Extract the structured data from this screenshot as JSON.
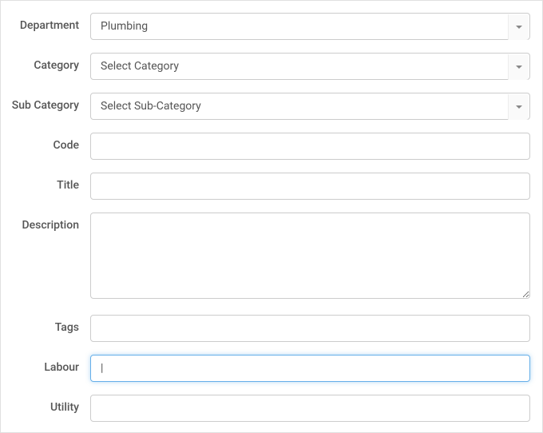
{
  "form": {
    "department": {
      "label": "Department",
      "value": "Plumbing"
    },
    "category": {
      "label": "Category",
      "value": "Select Category"
    },
    "subcategory": {
      "label": "Sub Category",
      "value": "Select Sub-Category"
    },
    "code": {
      "label": "Code",
      "value": ""
    },
    "title": {
      "label": "Title",
      "value": ""
    },
    "description": {
      "label": "Description",
      "value": ""
    },
    "tags": {
      "label": "Tags",
      "value": ""
    },
    "labour": {
      "label": "Labour",
      "value": ""
    },
    "utility": {
      "label": "Utility",
      "value": ""
    }
  }
}
